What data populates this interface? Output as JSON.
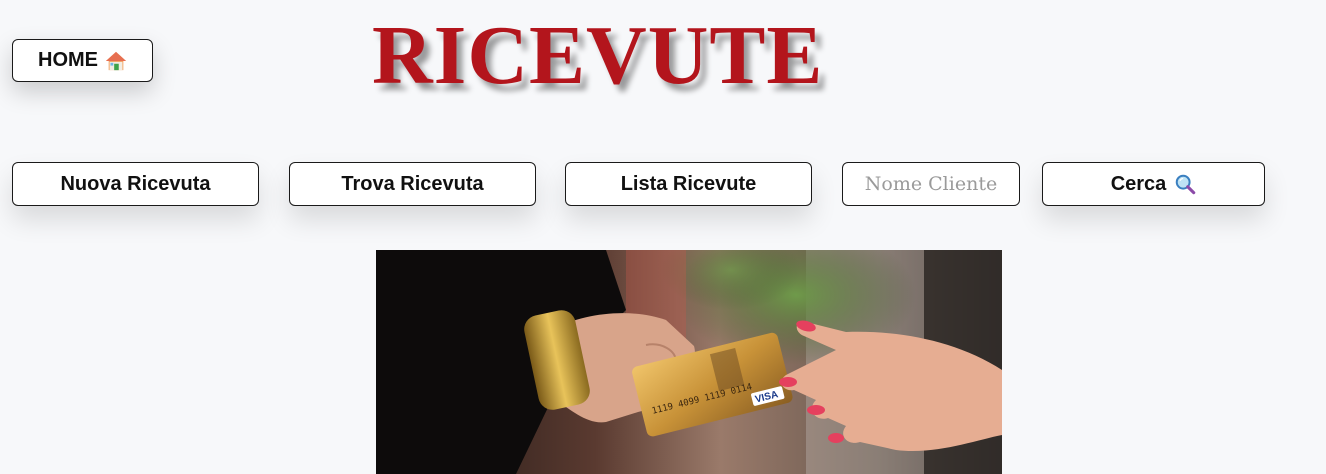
{
  "header": {
    "home_label": "HOME",
    "home_icon": "house-icon",
    "title": "RICEVUTE",
    "title_color": "#b3151c"
  },
  "nav": {
    "new_receipt_label": "Nuova Ricevuta",
    "find_receipt_label": "Trova Ricevuta",
    "list_receipts_label": "Lista Ricevute",
    "search_placeholder": "Nome Cliente",
    "search_value": "",
    "search_button_label": "Cerca",
    "search_icon": "magnifying-glass-icon"
  },
  "hero": {
    "image_subject": "hand-passing-credit-card-photo",
    "card_brand": "VISA"
  }
}
